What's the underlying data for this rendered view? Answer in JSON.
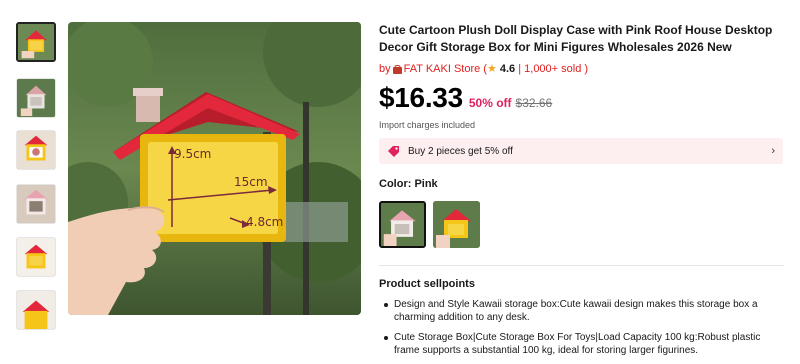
{
  "product": {
    "title": "Cute Cartoon Plush Doll Display Case with Pink Roof House Desktop Decor Gift Storage Box for Mini Figures Wholesales 2026 New",
    "store_prefix": "by",
    "store_name": "FAT KAKI Store",
    "rating": "4.6",
    "sold": "1,000+ sold",
    "price": "$16.33",
    "discount": "50% off",
    "original_price": "$32.66",
    "import_note": "Import charges included",
    "promo_text": "Buy 2 pieces get 5% off",
    "color_label": "Color: Pink",
    "sellpoints_title": "Product sellpoints",
    "sellpoints": [
      "Design and Style  Kawaii storage box:Cute kawaii design makes this storage box a charming addition to any desk.",
      "Cute Storage Box|Cute Storage Box For Toys|Load Capacity  100 kg:Robust plastic frame supports a substantial 100 kg, ideal for storing larger figurines."
    ]
  },
  "image": {
    "dim_height": "9.5cm",
    "dim_width": "15cm",
    "dim_depth": "4.8cm"
  },
  "icons": {
    "store": "store-bag-icon",
    "star": "star-icon",
    "promo": "coupon-tag-icon",
    "chevron": "chevron-right-icon"
  },
  "colors": {
    "accent_red": "#e02020",
    "discount_pink": "#e0215d",
    "promo_bg": "#fdeef0",
    "roof_red": "#e2283a",
    "box_yellow": "#f5c518"
  }
}
